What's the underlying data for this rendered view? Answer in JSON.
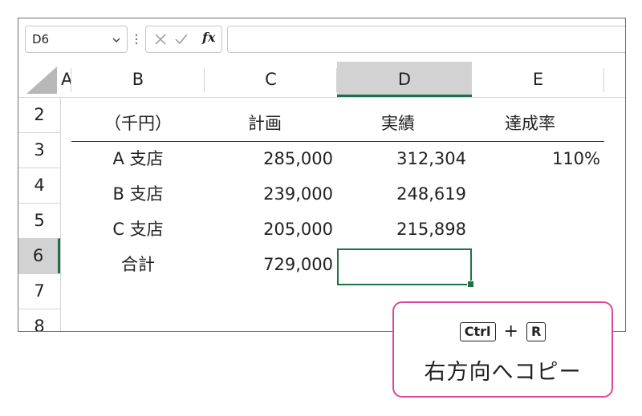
{
  "formula_bar": {
    "name_box": "D6",
    "fx_label": "fx",
    "formula_value": ""
  },
  "columns": [
    {
      "id": "A",
      "label": "A"
    },
    {
      "id": "B",
      "label": "B"
    },
    {
      "id": "C",
      "label": "C"
    },
    {
      "id": "D",
      "label": "D",
      "selected": true
    },
    {
      "id": "E",
      "label": "E"
    }
  ],
  "rows": [
    {
      "label": "2",
      "cells": {
        "B": "（千円）",
        "C": "計画",
        "D": "実績",
        "E": "達成率"
      }
    },
    {
      "label": "3",
      "cells": {
        "B": "A 支店",
        "C": "285,000",
        "D": "312,304",
        "E": "110%"
      }
    },
    {
      "label": "4",
      "cells": {
        "B": "B 支店",
        "C": "239,000",
        "D": "248,619",
        "E": ""
      }
    },
    {
      "label": "5",
      "cells": {
        "B": "C 支店",
        "C": "205,000",
        "D": "215,898",
        "E": ""
      }
    },
    {
      "label": "6",
      "cells": {
        "B": "合計",
        "C": "729,000",
        "D": "",
        "E": ""
      },
      "selected": true
    },
    {
      "label": "7",
      "cells": {
        "B": "",
        "C": "",
        "D": "",
        "E": ""
      }
    },
    {
      "label": "8",
      "cells": {
        "B": "",
        "C": "",
        "D": "",
        "E": ""
      }
    }
  ],
  "selected_cell": "D6",
  "callout": {
    "key1": "Ctrl",
    "plus": "+",
    "key2": "R",
    "text": "右方向へコピー"
  },
  "colors": {
    "selection_green": "#1e7145",
    "callout_border": "#e0479a",
    "header_selected_bg": "#d2d2d2"
  }
}
